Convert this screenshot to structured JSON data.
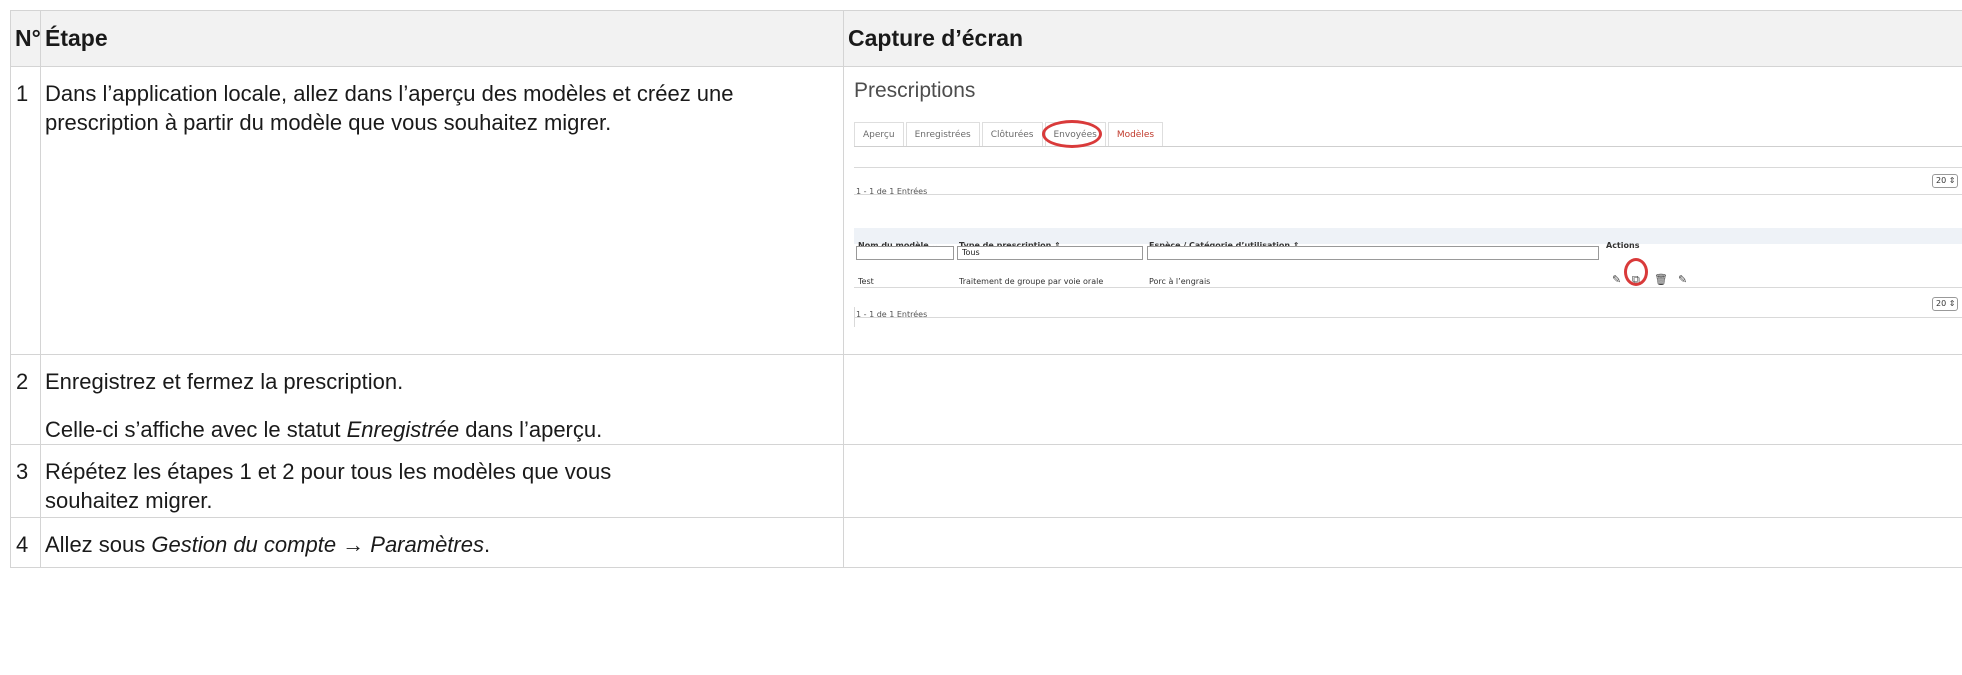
{
  "table": {
    "headers": {
      "num": "N°",
      "step": "Étape",
      "capture": "Capture d’écran"
    },
    "rows": [
      {
        "num": "1",
        "text": "Dans l’application locale, allez dans l’aperçu des modèles et créez une prescription à partir du modèle que vous souhaitez migrer."
      },
      {
        "num": "2",
        "text": "Enregistrez et fermez la prescription.",
        "note_before": "Celle-ci s’affiche avec le statut ",
        "note_emph": "Enregistrée",
        "note_after": " dans l’aperçu."
      },
      {
        "num": "3",
        "text": "Répétez les étapes 1 et 2 pour tous les modèles que vous souhaitez migrer."
      },
      {
        "num": "4",
        "text_before": "Allez sous ",
        "text_emph": "Gestion du compte → Paramètres",
        "text_after": "."
      }
    ]
  },
  "screenshot": {
    "title": "Prescriptions",
    "tabs": [
      "Aperçu",
      "Enregistrées",
      "Clôturées",
      "Envoyées",
      "Modèles"
    ],
    "active_tab": "Modèles",
    "entries_label": "1 - 1 de 1 Entrées",
    "page_size": "20 ⇕",
    "columns": [
      "Nom du modèle ⌄",
      "Type de prescription ⇕",
      "Espèce / Catégorie d’utilisation ⇕",
      "Actions"
    ],
    "filter_select": "Tous",
    "row": {
      "name": "Test",
      "type": "Traitement de groupe par voie orale",
      "species": "Porc à l’engrais"
    },
    "action_icons": [
      "edit-icon",
      "copy-icon",
      "delete-icon",
      "edit-alt-icon"
    ],
    "highlight_color": "#d93a3a"
  }
}
